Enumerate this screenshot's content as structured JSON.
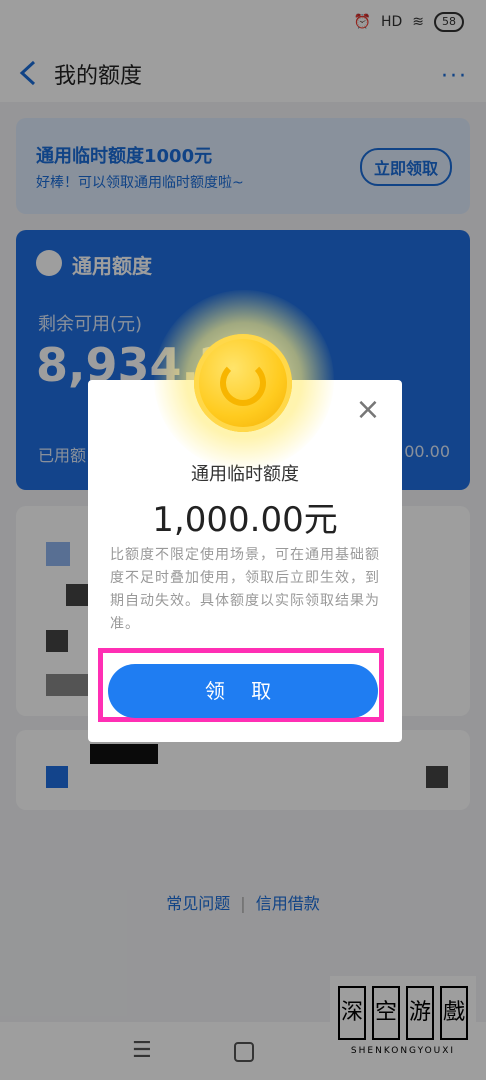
{
  "status_bar": {
    "network": "HD",
    "battery": "58"
  },
  "nav": {
    "title": "我的额度",
    "more": "···"
  },
  "promo": {
    "title": "通用临时额度1000元",
    "subtitle": "好棒！可以领取通用临时额度啦~",
    "button": "立即领取"
  },
  "credit": {
    "title": "通用额度",
    "remain_label": "剩余可用(元)",
    "remain_amount": "8,934.2",
    "used_label": "已用额",
    "total_amount": "00.00"
  },
  "footer": {
    "faq": "常见问题",
    "separator": "|",
    "loan": "信用借款"
  },
  "bottom_nav": {
    "menu": "☰"
  },
  "watermark": {
    "chars": [
      "深",
      "空",
      "游",
      "戲"
    ],
    "subtitle": "SHENKONGYOUXI"
  },
  "modal": {
    "title": "通用临时额度",
    "amount": "1,000.00元",
    "description": "比额度不限定使用场景，可在通用基础额度不足时叠加使用，领取后立即生效，到期自动失效。具体额度以实际领取结果为准。",
    "button": "领 取",
    "close": "×"
  },
  "colors": {
    "brand_blue": "#1f6fe0",
    "highlight": "#ff2fb4",
    "coin": "#ffcb1f"
  }
}
